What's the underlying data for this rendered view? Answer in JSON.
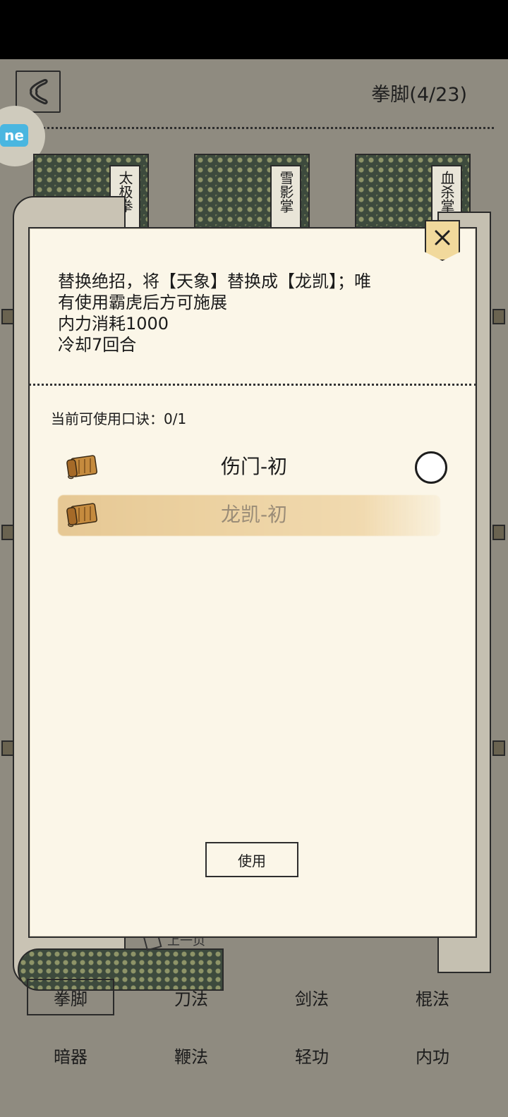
{
  "background": {
    "title": "拳脚(4/23)",
    "badge_text": "ne",
    "books": [
      {
        "label": "太极拳"
      },
      {
        "label": "雪影掌"
      },
      {
        "label": "血杀掌"
      }
    ],
    "prev_page_label": "上一页"
  },
  "tabs": [
    {
      "label": "拳脚",
      "active": true
    },
    {
      "label": "刀法",
      "active": false
    },
    {
      "label": "剑法",
      "active": false
    },
    {
      "label": "棍法",
      "active": false
    },
    {
      "label": "暗器",
      "active": false
    },
    {
      "label": "鞭法",
      "active": false
    },
    {
      "label": "轻功",
      "active": false
    },
    {
      "label": "内功",
      "active": false
    }
  ],
  "modal": {
    "close_icon": "close-icon",
    "description_lines": [
      "替换绝招，将【天象】替换成【龙凯】；唯",
      "有使用霸虎后方可施展",
      "内力消耗1000",
      "冷却7回合"
    ],
    "subtitle": "当前可使用口诀：0/1",
    "items": [
      {
        "name": "伤门-初",
        "icon": "scroll-icon",
        "selectable": true
      },
      {
        "name": "龙凯-初",
        "icon": "scroll-icon",
        "selectable": false
      }
    ],
    "use_button_label": "使用"
  },
  "colors": {
    "modal_bg": "#fbf6e8",
    "highlight": "#edd3a3",
    "close_bg": "#f1d99c",
    "dim_bg": "#8f8b80"
  }
}
